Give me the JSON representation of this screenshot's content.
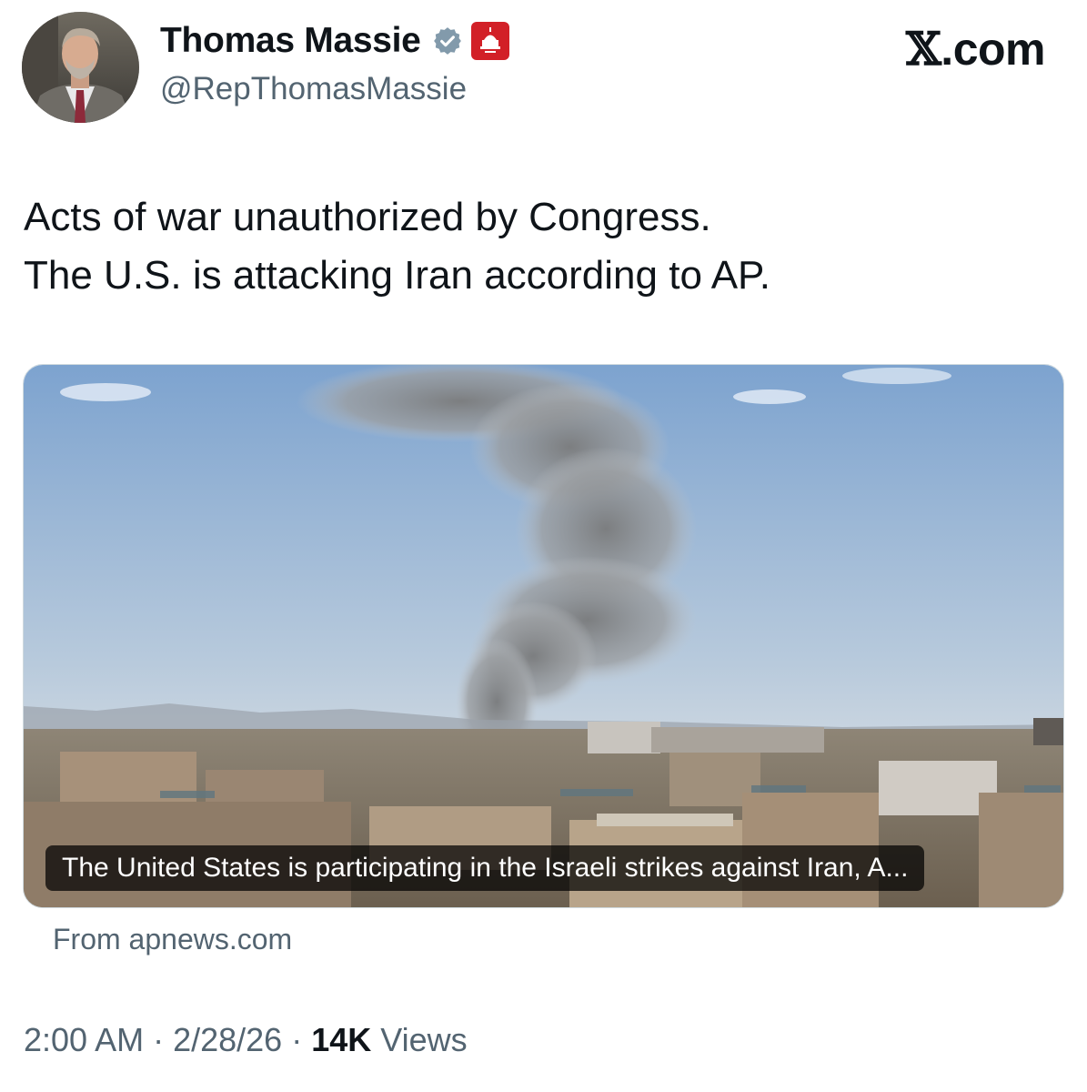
{
  "author": {
    "display_name": "Thomas Massie",
    "handle": "@RepThomasMassie",
    "verified_icon": "verified-badge-icon",
    "org_badge_icon": "house-gop-capitol-icon",
    "avatar_icon": "profile-photo"
  },
  "brand": {
    "x_glyph": "𝕏",
    "suffix": ".com"
  },
  "tweet": {
    "line1": "Acts of war unauthorized by Congress.",
    "line2": "The U.S. is attacking Iran according to AP."
  },
  "link_card": {
    "image_icon": "smoke-over-city-photo",
    "caption": "The United States is participating in the Israeli strikes against Iran, A...",
    "source": "From apnews.com"
  },
  "meta": {
    "time": "2:00 AM",
    "separator": " · ",
    "date": "2/28/26",
    "views_count": "14K",
    "views_label": " Views"
  },
  "colors": {
    "text_primary": "#0f1419",
    "text_secondary": "#536471",
    "verified_blue": "#829aab",
    "org_red": "#d22027"
  }
}
